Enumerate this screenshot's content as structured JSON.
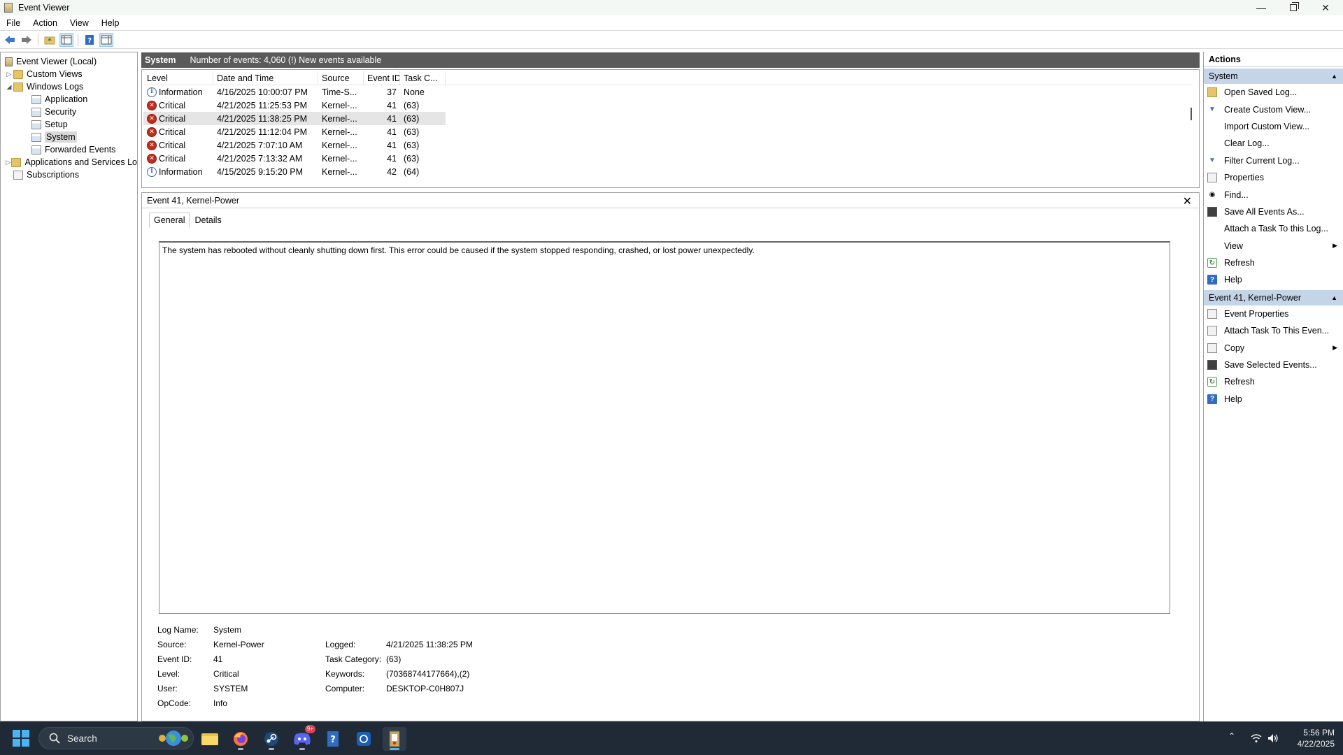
{
  "window": {
    "title": "Event Viewer"
  },
  "menu": [
    "File",
    "Action",
    "View",
    "Help"
  ],
  "tree": {
    "root": "Event Viewer (Local)",
    "custom_views": "Custom Views",
    "windows_logs": "Windows Logs",
    "logs": [
      "Application",
      "Security",
      "Setup",
      "System",
      "Forwarded Events"
    ],
    "apps_services": "Applications and Services Lo",
    "subscriptions": "Subscriptions"
  },
  "center": {
    "header_title": "System",
    "header_info": "Number of events: 4,060 (!) New events available",
    "columns": [
      "Level",
      "Date and Time",
      "Source",
      "Event ID",
      "Task C..."
    ],
    "rows": [
      {
        "level": "Information",
        "date": "4/16/2025 10:00:07 PM",
        "source": "Time-S...",
        "event_id": "37",
        "task": "None"
      },
      {
        "level": "Critical",
        "date": "4/21/2025 11:25:53 PM",
        "source": "Kernel-...",
        "event_id": "41",
        "task": "(63)"
      },
      {
        "level": "Critical",
        "date": "4/21/2025 11:38:25 PM",
        "source": "Kernel-...",
        "event_id": "41",
        "task": "(63)"
      },
      {
        "level": "Critical",
        "date": "4/21/2025 11:12:04 PM",
        "source": "Kernel-...",
        "event_id": "41",
        "task": "(63)"
      },
      {
        "level": "Critical",
        "date": "4/21/2025 7:07:10 AM",
        "source": "Kernel-...",
        "event_id": "41",
        "task": "(63)"
      },
      {
        "level": "Critical",
        "date": "4/21/2025 7:13:32 AM",
        "source": "Kernel-...",
        "event_id": "41",
        "task": "(63)"
      },
      {
        "level": "Information",
        "date": "4/15/2025 9:15:20 PM",
        "source": "Kernel-...",
        "event_id": "42",
        "task": "(64)"
      }
    ]
  },
  "detail": {
    "title": "Event 41, Kernel-Power",
    "tabs": [
      "General",
      "Details"
    ],
    "message": "The system has rebooted without cleanly shutting down first. This error could be caused if the system stopped responding, crashed, or lost power unexpectedly.",
    "log_name_label": "Log Name:",
    "log_name": "System",
    "source_label": "Source:",
    "source": "Kernel-Power",
    "event_id_label": "Event ID:",
    "event_id": "41",
    "level_label": "Level:",
    "level": "Critical",
    "user_label": "User:",
    "user": "SYSTEM",
    "opcode_label": "OpCode:",
    "opcode": "Info",
    "logged_label": "Logged:",
    "logged": "4/21/2025 11:38:25 PM",
    "task_category_label": "Task Category:",
    "task_category": "(63)",
    "keywords_label": "Keywords:",
    "keywords": "(70368744177664),(2)",
    "computer_label": "Computer:",
    "computer": "DESKTOP-C0H807J"
  },
  "actions": {
    "title": "Actions",
    "section1": "System",
    "items1": [
      "Open Saved Log...",
      "Create Custom View...",
      "Import Custom View...",
      "Clear Log...",
      "Filter Current Log...",
      "Properties",
      "Find...",
      "Save All Events As...",
      "Attach a Task To this Log...",
      "View",
      "Refresh",
      "Help"
    ],
    "section2": "Event 41, Kernel-Power",
    "items2": [
      "Event Properties",
      "Attach Task To This Even...",
      "Copy",
      "Save Selected Events...",
      "Refresh",
      "Help"
    ]
  },
  "taskbar": {
    "search_label": "Search",
    "discord_badge": "9+",
    "time": "5:56 PM",
    "date": "4/22/2025"
  }
}
